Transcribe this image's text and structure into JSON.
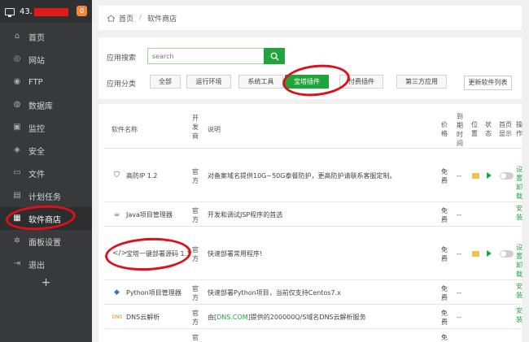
{
  "sidebar": {
    "ip_text": "43.",
    "badge": "0",
    "plus": "+",
    "items": [
      {
        "label": "首页",
        "icon": "home-icon",
        "glyph": "⌂"
      },
      {
        "label": "网站",
        "icon": "globe-icon",
        "glyph": "◎"
      },
      {
        "label": "FTP",
        "icon": "ftp-icon",
        "glyph": "◉"
      },
      {
        "label": "数据库",
        "icon": "database-icon",
        "glyph": "◍"
      },
      {
        "label": "监控",
        "icon": "monitor-icon",
        "glyph": "▣"
      },
      {
        "label": "安全",
        "icon": "shield-icon",
        "glyph": "◈"
      },
      {
        "label": "文件",
        "icon": "folder-icon",
        "glyph": "▭"
      },
      {
        "label": "计划任务",
        "icon": "calendar-icon",
        "glyph": "▤"
      },
      {
        "label": "软件商店",
        "icon": "grid-icon",
        "glyph": "▦"
      },
      {
        "label": "面板设置",
        "icon": "gear-icon",
        "glyph": "✲"
      },
      {
        "label": "退出",
        "icon": "logout-icon",
        "glyph": "⇥"
      }
    ]
  },
  "breadcrumb": {
    "home": "首页",
    "sep": "/",
    "current": "软件商店"
  },
  "search": {
    "label": "应用搜索",
    "placeholder": "search"
  },
  "categories": {
    "label": "应用分类",
    "items": [
      "全部",
      "运行环境",
      "系统工具",
      "宝塔插件",
      "付费插件",
      "第三方应用"
    ],
    "active": "宝塔插件",
    "refresh": "更新软件列表"
  },
  "table": {
    "headers": {
      "name": "软件名称",
      "dev": "开发商",
      "desc": "说明",
      "price": "价格",
      "expire": "到期时间",
      "location": "位置",
      "status": "状态",
      "home_show": "首页显示",
      "ops": "操作"
    },
    "rows": [
      {
        "name": "高防IP 1.2",
        "icon": "shield-icon",
        "glyph": "⛉",
        "dev": "官方",
        "desc": "对备案域名提供10G~50G泰餐防护，更高防护请联系客服定制。",
        "price": "免费",
        "expire": "--",
        "has_controls": true,
        "ops": [
          "设置",
          "卸载"
        ]
      },
      {
        "name": "Java项目管理器",
        "icon": "java-icon",
        "glyph": "☕",
        "dev": "官方",
        "desc": "开发和调试JSP程序的首选",
        "price": "免费",
        "expire": "--",
        "has_controls": false,
        "ops": [
          "安装"
        ]
      },
      {
        "name": "宝塔一键部署源码 1.1",
        "icon": "code-icon",
        "glyph": "</>",
        "dev": "官方",
        "desc": "快速部署常用程序!",
        "price": "免费",
        "expire": "--",
        "has_controls": true,
        "ops": [
          "设置",
          "卸载"
        ]
      },
      {
        "name": "Python项目管理器",
        "icon": "python-icon",
        "glyph": "◆",
        "dev": "官方",
        "desc": "快速部署Python项目，当前仅支持Centos7.x",
        "price": "免费",
        "expire": "--",
        "has_controls": false,
        "ops": [
          "安装"
        ]
      },
      {
        "name": "DNS云解析",
        "icon": "dns-icon",
        "glyph": "DNS",
        "dev": "官方",
        "desc_pre": "由[",
        "desc_link": "DNS.COM",
        "desc_post": "]提供的200000Q/S域名DNS云解析服务",
        "price": "免费",
        "expire": "--",
        "has_controls": false,
        "ops": [
          "安装"
        ]
      },
      {
        "name": "",
        "icon": "app-icon",
        "glyph": "",
        "dev": "官方",
        "desc": "",
        "price": "免费",
        "expire": "",
        "has_controls": false,
        "ops": []
      }
    ]
  },
  "colors": {
    "accent": "#20a53a",
    "sidebar": "#37393b",
    "annotation": "#e0101a"
  }
}
